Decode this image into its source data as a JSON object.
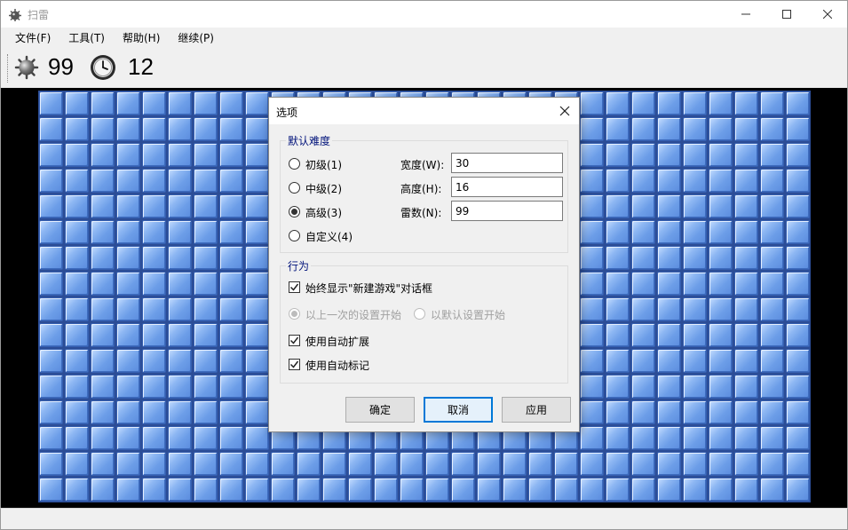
{
  "window": {
    "title": "扫雷"
  },
  "menu": [
    {
      "label": "文件(F)"
    },
    {
      "label": "工具(T)"
    },
    {
      "label": "帮助(H)"
    },
    {
      "label": "继续(P)"
    }
  ],
  "toolbar": {
    "mines_remaining": "99",
    "timer": "12",
    "mine_icon": "mine-icon",
    "timer_icon": "clock-icon"
  },
  "board": {
    "columns": 30,
    "rows": 16,
    "cell_color": "#7aa6ea"
  },
  "dialog": {
    "title": "选项",
    "difficulty_group": {
      "legend": "默认难度",
      "options": [
        {
          "label": "初级(1)",
          "checked": false
        },
        {
          "label": "中级(2)",
          "checked": false
        },
        {
          "label": "高级(3)",
          "checked": true
        },
        {
          "label": "自定义(4)",
          "checked": false
        }
      ],
      "width_label": "宽度(W):",
      "width_value": "30",
      "height_label": "高度(H):",
      "height_value": "16",
      "mines_label": "雷数(N):",
      "mines_value": "99"
    },
    "behavior_group": {
      "legend": "行为",
      "always_show_new_game": "始终显示\"新建游戏\"对话框",
      "start_from_last": "以上一次的设置开始",
      "start_from_default": "以默认设置开始",
      "auto_expand": "使用自动扩展",
      "auto_flag": "使用自动标记"
    },
    "buttons": {
      "ok": "确定",
      "cancel": "取消",
      "apply": "应用"
    }
  }
}
